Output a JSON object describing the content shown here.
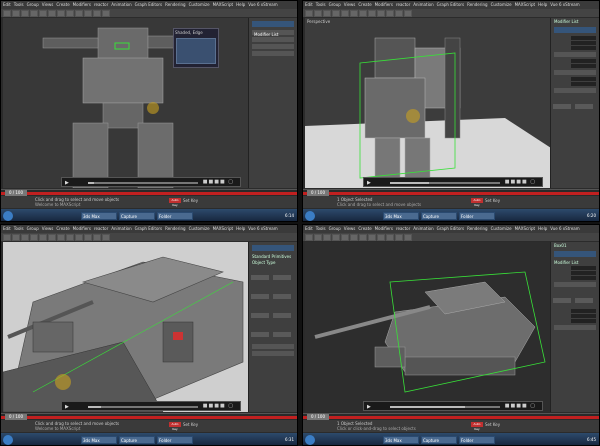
{
  "menu": [
    "Edit",
    "Tools",
    "Group",
    "Views",
    "Create",
    "Modifiers",
    "reactor",
    "Animation",
    "Graph Editors",
    "Rendering",
    "Customize",
    "MAXScript",
    "Help",
    "Vue 6 xStream"
  ],
  "panels": [
    {
      "id": "tl",
      "name_box": "Shaded, Edge",
      "cmd_header": "Modifier List",
      "status_line": "Click and drag to select and move objects",
      "status_line2": "Welcome to MAXScript",
      "time_slider": "0 / 100",
      "progress": 0.05,
      "autokey": "Auto Key",
      "setkey": "Set Key",
      "taskbar_items": [
        "3ds Max",
        "Capture",
        "Folder"
      ],
      "clock": "6:14"
    },
    {
      "id": "tr",
      "name_box": "Perspective",
      "cmd_header": "Modifier List",
      "status_line": "1 Object Selected",
      "status_line2": "Click and drag to select and move objects",
      "time_slider": "0 / 100",
      "progress": 0.35,
      "autokey": "Auto Key",
      "setkey": "Set Key",
      "taskbar_items": [
        "3ds Max",
        "Capture",
        "Folder"
      ],
      "clock": "6:20"
    },
    {
      "id": "bl",
      "name_box": "Standard Primitives",
      "cmd_header": "Object Type",
      "status_line": "Click and drag to select and move objects",
      "status_line2": "Welcome to MAXScript",
      "time_slider": "0 / 100",
      "progress": 0.12,
      "autokey": "Auto Key",
      "setkey": "Set Key",
      "taskbar_items": [
        "3ds Max",
        "Capture",
        "Folder"
      ],
      "clock": "6:31"
    },
    {
      "id": "br",
      "name_box": "Box01",
      "cmd_header": "Modifier List",
      "status_line": "1 Object Selected",
      "status_line2": "Click or click-and-drag to select objects",
      "time_slider": "0 / 100",
      "progress": 0.68,
      "autokey": "Auto Key",
      "setkey": "Set Key",
      "taskbar_items": [
        "3ds Max",
        "Capture",
        "Folder"
      ],
      "clock": "6:45"
    }
  ],
  "colors": {
    "timeline_red": "#c12020",
    "select_box": "#38e038",
    "floor": "#d8d8d8"
  },
  "icons": {
    "play": "play-icon",
    "volume": "volume-icon",
    "fullscreen": "fullscreen-icon"
  }
}
